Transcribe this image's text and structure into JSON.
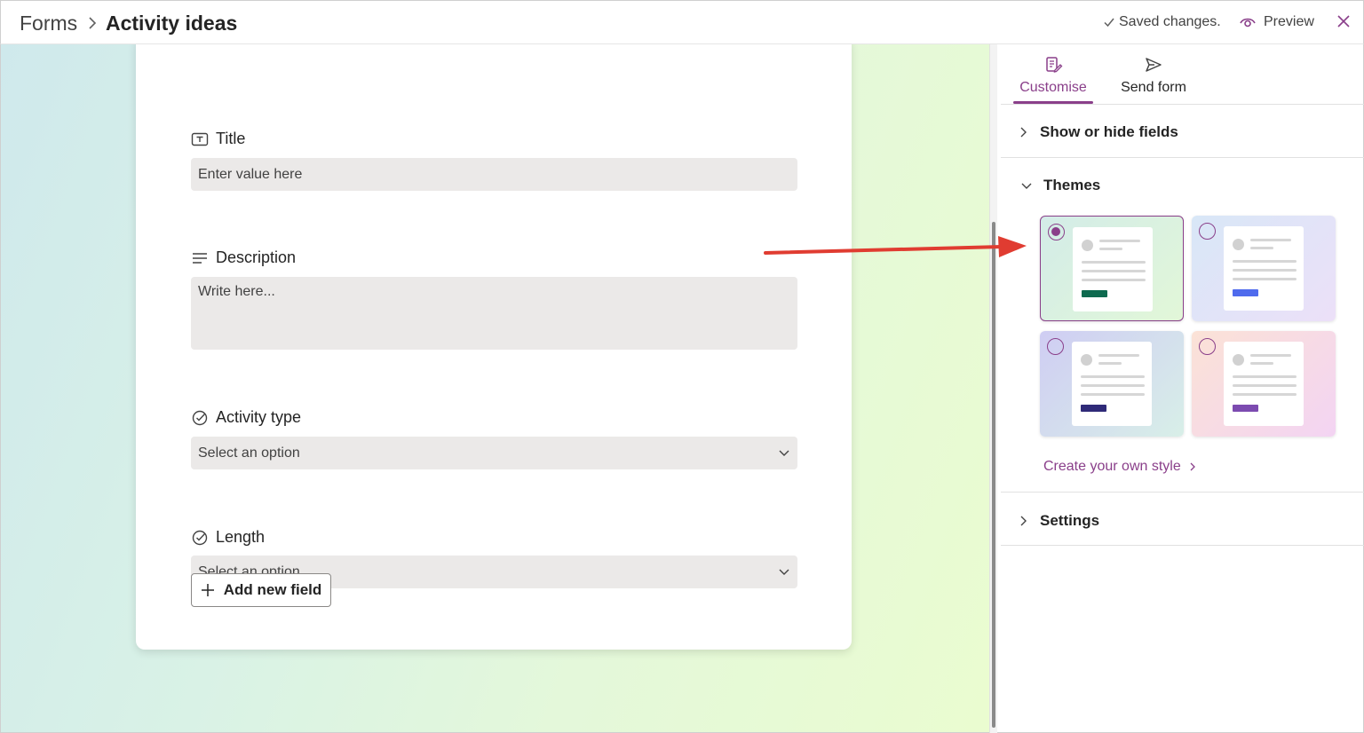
{
  "header": {
    "breadcrumb_root": "Forms",
    "breadcrumb_current": "Activity ideas",
    "saved_text": "Saved changes.",
    "preview_label": "Preview"
  },
  "form": {
    "fields": [
      {
        "label": "Title",
        "placeholder": "Enter value here",
        "icon": "text-field-icon"
      },
      {
        "label": "Description",
        "placeholder": "Write here...",
        "icon": "multiline-text-icon"
      },
      {
        "label": "Activity type",
        "placeholder": "Select an option",
        "icon": "choice-check-icon"
      },
      {
        "label": "Length",
        "placeholder": "Select an option",
        "icon": "choice-check-icon"
      }
    ],
    "add_field_label": "Add new field"
  },
  "panel": {
    "tabs": [
      {
        "label": "Customise",
        "icon": "form-edit-icon",
        "active": true
      },
      {
        "label": "Send form",
        "icon": "send-icon",
        "active": false
      }
    ],
    "show_hide_label": "Show or hide fields",
    "themes_label": "Themes",
    "themes": [
      {
        "selected": true,
        "bg": "#d9efe6",
        "accent": "#0e6a4f"
      },
      {
        "selected": false,
        "bg": "#dfe6f8",
        "accent": "#4f6bed"
      },
      {
        "selected": false,
        "bg": "#d6d6f2",
        "accent": "#2f2a78"
      },
      {
        "selected": false,
        "bg": "#f6dfe6",
        "accent": "#7c4bb0"
      }
    ],
    "create_style_label": "Create your own style",
    "settings_label": "Settings"
  },
  "colors": {
    "accent": "#8a3f8a",
    "annotation_arrow": "#e03c31"
  }
}
